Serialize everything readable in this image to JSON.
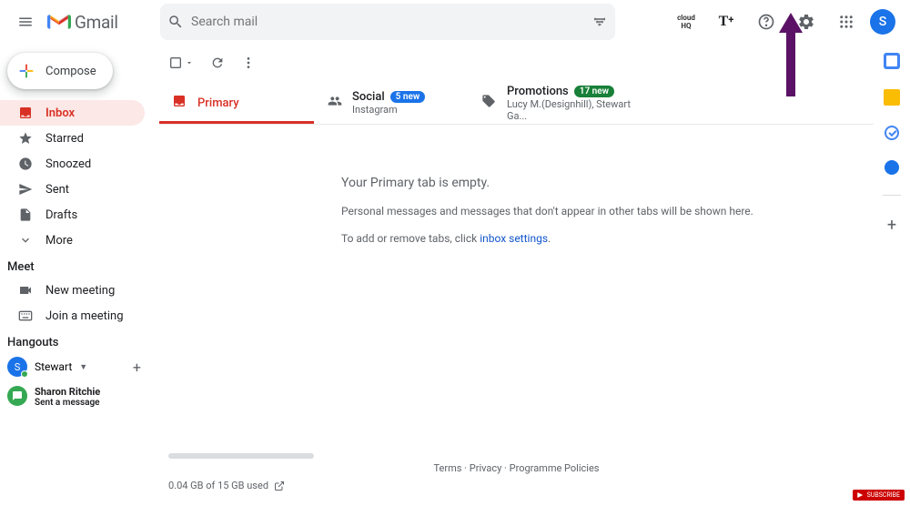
{
  "header": {
    "app_name": "Gmail",
    "search_placeholder": "Search mail",
    "avatar_initial": "S",
    "cloudhq_top": "cloud",
    "cloudhq_bottom": "HQ"
  },
  "sidebar": {
    "compose": "Compose",
    "nav": [
      {
        "label": "Inbox",
        "icon": "inbox"
      },
      {
        "label": "Starred",
        "icon": "star"
      },
      {
        "label": "Snoozed",
        "icon": "clock"
      },
      {
        "label": "Sent",
        "icon": "send"
      },
      {
        "label": "Drafts",
        "icon": "draft"
      },
      {
        "label": "More",
        "icon": "chevron"
      }
    ],
    "meet_label": "Meet",
    "meet_items": [
      {
        "label": "New meeting",
        "icon": "video"
      },
      {
        "label": "Join a meeting",
        "icon": "keyboard"
      }
    ],
    "hangouts_label": "Hangouts",
    "hangouts_user": "Stewart",
    "chat_name": "Sharon Ritchie",
    "chat_sub": "Sent a message"
  },
  "tabs": [
    {
      "label": "Primary",
      "badge": "",
      "sub": ""
    },
    {
      "label": "Social",
      "badge": "5 new",
      "sub": "Instagram"
    },
    {
      "label": "Promotions",
      "badge": "17 new",
      "sub": "Lucy M.(Designhill), Stewart Ga..."
    }
  ],
  "empty": {
    "title": "Your Primary tab is empty.",
    "text1": "Personal messages and messages that don't appear in other tabs will be shown here.",
    "text2_prefix": "To add or remove tabs, click ",
    "text2_link": "inbox settings",
    "text2_suffix": "."
  },
  "footer": {
    "terms": "Terms",
    "privacy": "Privacy",
    "programme": "Programme Policies",
    "storage": "0.04 GB of 15 GB used"
  },
  "subscribe": "SUBSCRIBE"
}
